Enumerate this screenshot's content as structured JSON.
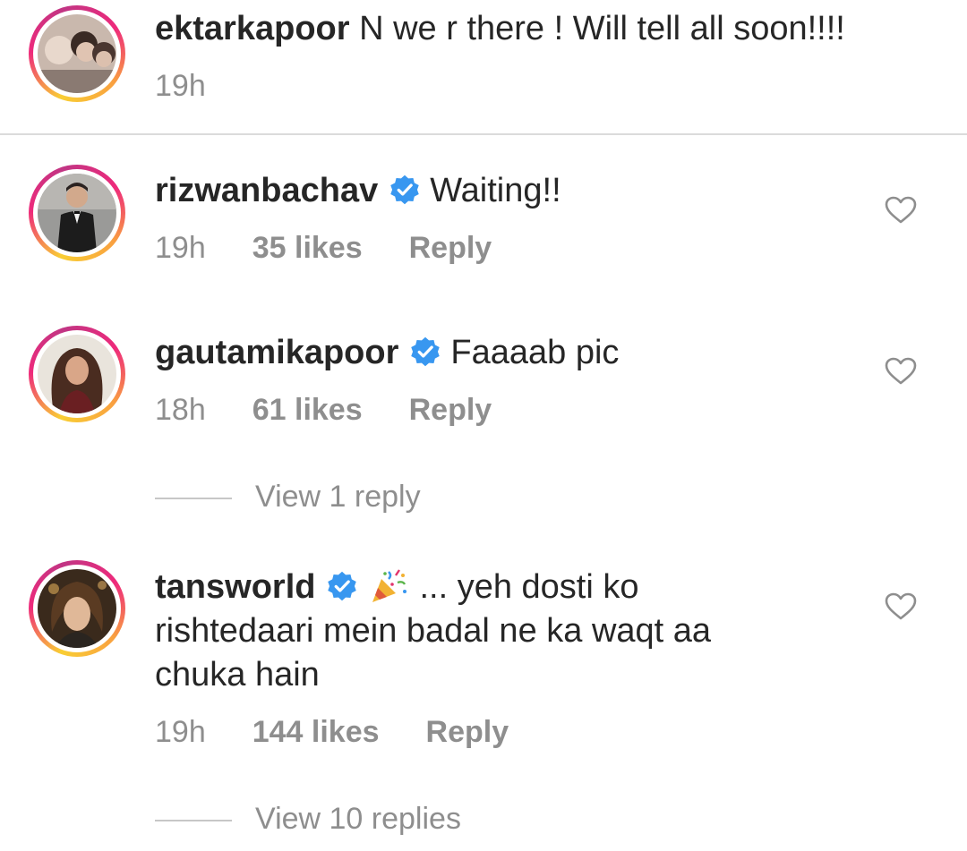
{
  "caption": {
    "username": "ektarkapoor",
    "text": "N we r there ! Will tell all soon!!!!",
    "time": "19h"
  },
  "comments": [
    {
      "username": "rizwanbachav",
      "verified": true,
      "text": "Waiting!!",
      "time": "19h",
      "likes": "35 likes",
      "reply": "Reply"
    },
    {
      "username": "gautamikapoor",
      "verified": true,
      "text": "Faaaab pic",
      "time": "18h",
      "likes": "61 likes",
      "reply": "Reply",
      "view_replies": "View 1 reply"
    },
    {
      "username": "tansworld",
      "verified": true,
      "text_line1": "... yeh dosti ko",
      "text_line2": "rishtedaari mein badal ne ka waqt aa",
      "text_line3": "chuka hain",
      "time": "19h",
      "likes": "144 likes",
      "reply": "Reply",
      "view_replies": "View 10 replies"
    }
  ],
  "icons": {
    "verified": "verified-badge-icon",
    "like": "heart-outline-icon",
    "party": "party-popper-emoji"
  },
  "colors": {
    "text": "#262626",
    "secondary": "#8e8e8e",
    "verified_blue": "#3897f0",
    "divider": "#dbdbdb"
  }
}
